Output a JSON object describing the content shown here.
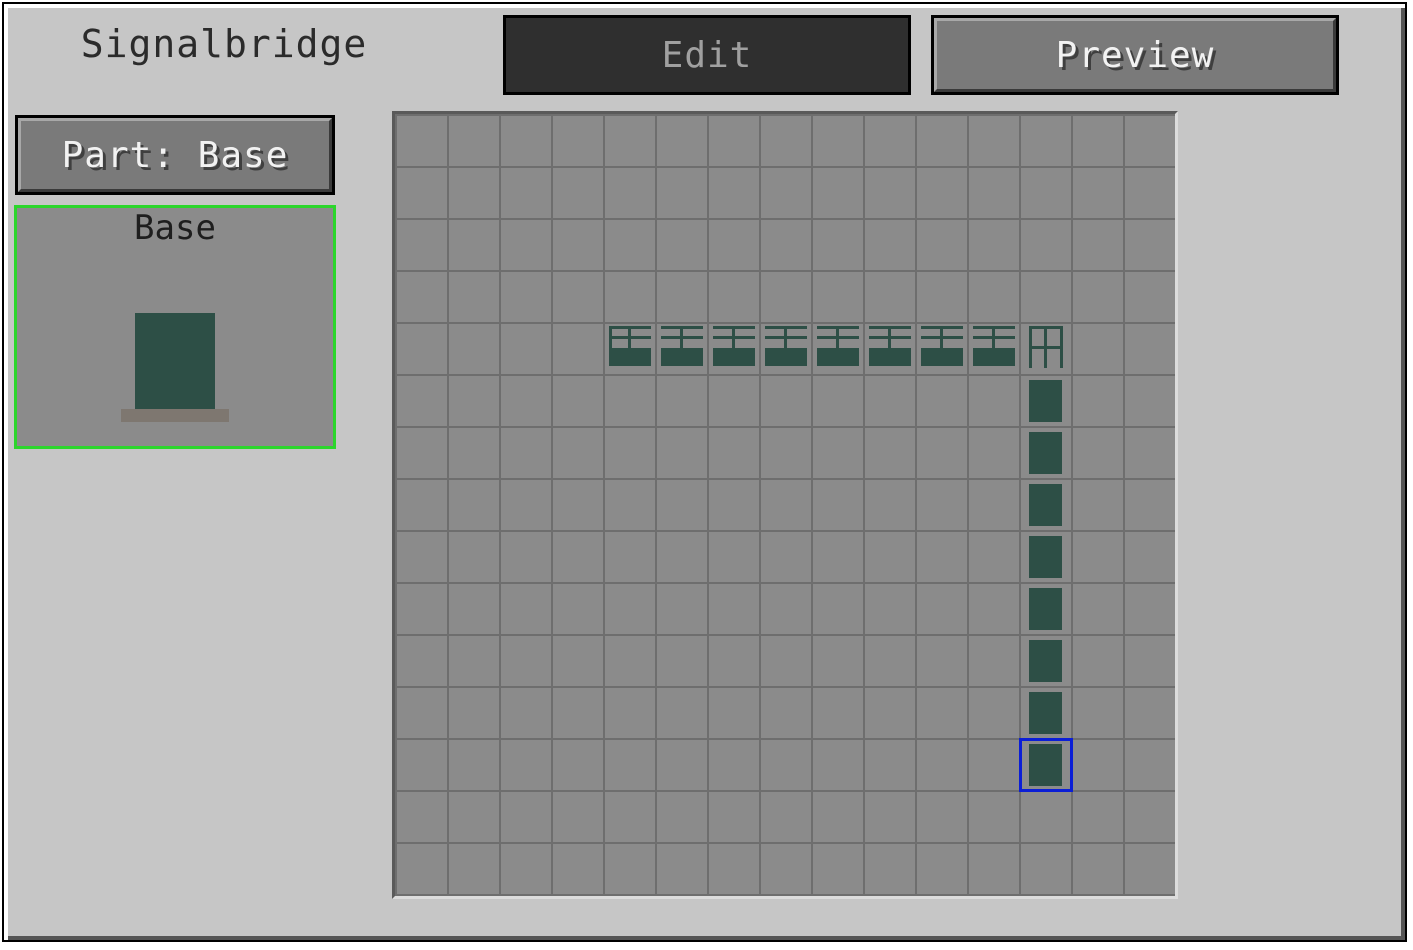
{
  "window": {
    "title": "Signalbridge"
  },
  "tabs": {
    "edit_label": "Edit",
    "edit_state": "disabled",
    "preview_label": "Preview"
  },
  "part_selector": {
    "label": "Part: Base"
  },
  "part_preview": {
    "label": "Base",
    "selected": true,
    "highlight_color": "#2bd62b"
  },
  "colors": {
    "piece": "#2d4f46",
    "grid_cell": "#8b8b8b",
    "grid_line": "#6e6e6e",
    "selection": "#0b1ed6"
  },
  "grid": {
    "cols": 15,
    "rows": 15,
    "pieces": [
      {
        "col": 4,
        "row": 4,
        "type": "beam-end"
      },
      {
        "col": 5,
        "row": 4,
        "type": "beam"
      },
      {
        "col": 6,
        "row": 4,
        "type": "beam"
      },
      {
        "col": 7,
        "row": 4,
        "type": "beam"
      },
      {
        "col": 8,
        "row": 4,
        "type": "beam"
      },
      {
        "col": 9,
        "row": 4,
        "type": "beam"
      },
      {
        "col": 10,
        "row": 4,
        "type": "beam"
      },
      {
        "col": 11,
        "row": 4,
        "type": "beam"
      },
      {
        "col": 12,
        "row": 4,
        "type": "corner"
      },
      {
        "col": 12,
        "row": 5,
        "type": "pole"
      },
      {
        "col": 12,
        "row": 6,
        "type": "pole"
      },
      {
        "col": 12,
        "row": 7,
        "type": "pole"
      },
      {
        "col": 12,
        "row": 8,
        "type": "pole"
      },
      {
        "col": 12,
        "row": 9,
        "type": "pole"
      },
      {
        "col": 12,
        "row": 10,
        "type": "pole"
      },
      {
        "col": 12,
        "row": 11,
        "type": "pole"
      },
      {
        "col": 12,
        "row": 12,
        "type": "pole",
        "selected": true
      }
    ]
  }
}
